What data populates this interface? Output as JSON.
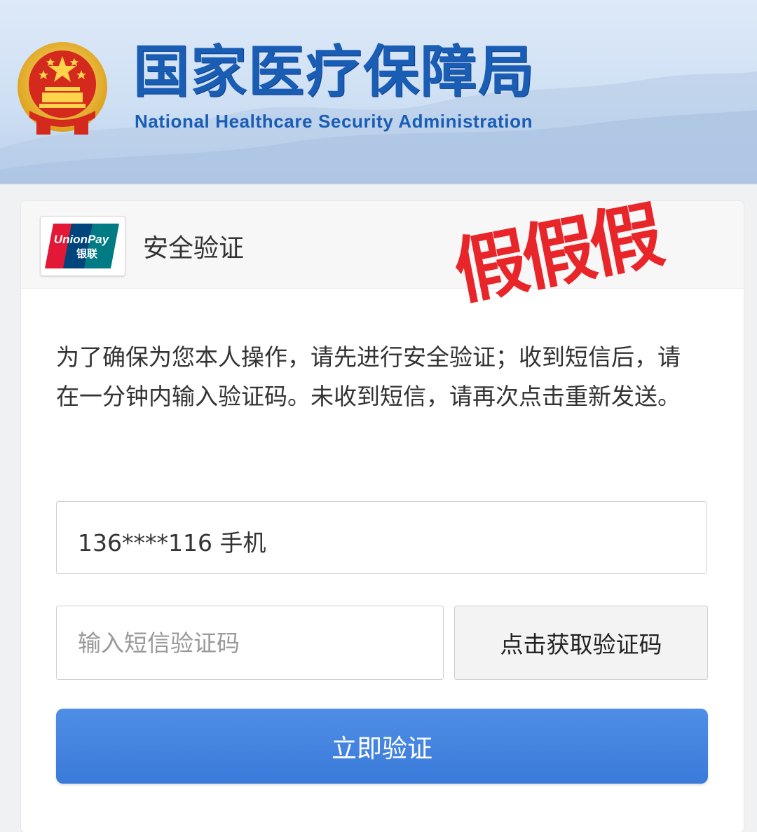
{
  "header": {
    "title_cn": "国家医疗保障局",
    "title_en": "National Healthcare Security Administration"
  },
  "card": {
    "logo_text_top": "UnionPay",
    "logo_text_bottom": "银联",
    "title": "安全验证",
    "stamp": "假假假",
    "description": "为了确保为您本人操作，请先进行安全验证；收到短信后，请在一分钟内输入验证码。未收到短信，请再次点击重新发送。",
    "phone_display": "136****116 手机",
    "code_placeholder": "输入短信验证码",
    "get_code_label": "点击获取验证码",
    "verify_label": "立即验证"
  },
  "colors": {
    "brand_blue": "#1a5db5",
    "button_blue": "#3f80dd",
    "stamp_red": "#e8262a"
  }
}
